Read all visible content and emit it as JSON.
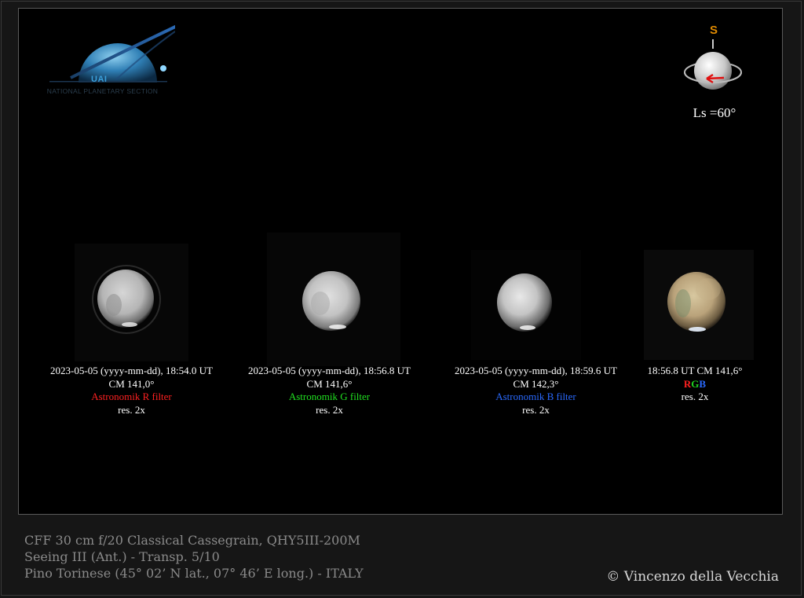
{
  "logo": {
    "acronym": "UAI",
    "subtitle": "NATIONAL PLANETARY SECTION"
  },
  "season": {
    "pole_label": "S",
    "ls_text": "Ls =60°"
  },
  "panels": [
    {
      "time_line": "2023-05-05 (yyyy-mm-dd), 18:54.0 UT",
      "cm_line": "CM 141,0°",
      "filter_line": "Astronomik R filter",
      "res_line": "res. 2x"
    },
    {
      "time_line": "2023-05-05 (yyyy-mm-dd), 18:56.8 UT",
      "cm_line": "CM 141,6°",
      "filter_line": "Astronomik G filter",
      "res_line": "res. 2x"
    },
    {
      "time_line": "2023-05-05 (yyyy-mm-dd), 18:59.6 UT",
      "cm_line": "CM 142,3°",
      "filter_line": "Astronomik B filter",
      "res_line": "res. 2x"
    },
    {
      "time_line": "18:56.8 UT  CM 141,6°",
      "rgb_r": "R",
      "rgb_g": "G",
      "rgb_b": "B",
      "res_line": "res. 2x"
    }
  ],
  "info": {
    "line1": "CFF 30 cm f/20 Classical Cassegrain, QHY5III-200M",
    "line2": "Seeing  III (Ant.) - Transp. 5/10",
    "line3": "Pino Torinese (45° 02’ N lat., 07° 46’ E long.) - ITALY"
  },
  "copyright": "© Vincenzo della Vecchia"
}
